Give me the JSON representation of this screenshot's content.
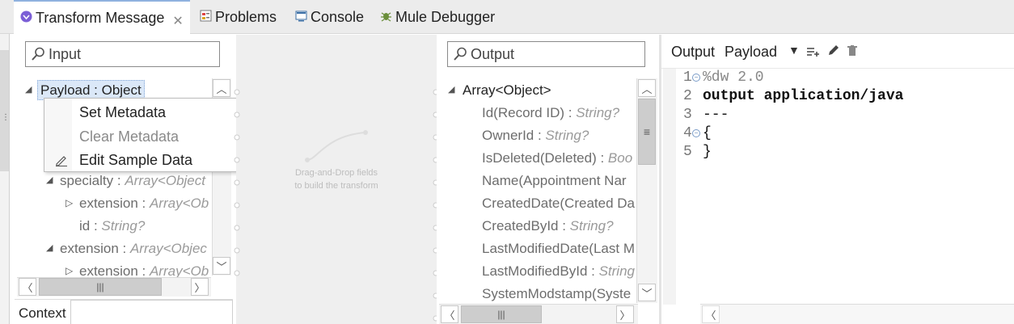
{
  "tabs": [
    {
      "label": "Transform Message",
      "icon": "transform-message-icon"
    },
    {
      "label": "Problems",
      "icon": "problems-icon"
    },
    {
      "label": "Console",
      "icon": "console-icon"
    },
    {
      "label": "Mule Debugger",
      "icon": "debugger-icon"
    }
  ],
  "input": {
    "search_placeholder": "Input",
    "tree": {
      "payload": "Payload : Object",
      "specialty_name": "specialty : ",
      "specialty_type": "Array<Object",
      "extension1_name": "extension : ",
      "extension1_type": "Array<Ob",
      "id_name": "id : ",
      "id_type": "String?",
      "extension2_name": "extension : ",
      "extension2_type": "Array<Objec",
      "extension3_name": "extension : ",
      "extension3_type": "Array<Ob"
    },
    "context_label": "Context"
  },
  "context_menu": {
    "set_metadata": "Set Metadata",
    "clear_metadata": "Clear Metadata",
    "edit_sample_data": "Edit Sample Data"
  },
  "mapping": {
    "hint_line1": "Drag-and-Drop fields",
    "hint_line2": "to build the transform"
  },
  "output": {
    "search_placeholder": "Output",
    "root": "Array<Object>",
    "fields": [
      {
        "name": "Id(Record ID) : ",
        "type": "String?"
      },
      {
        "name": "OwnerId : ",
        "type": "String?"
      },
      {
        "name": "IsDeleted(Deleted) : ",
        "type": "Boo"
      },
      {
        "name": "Name(Appointment Nar",
        "type": ""
      },
      {
        "name": "CreatedDate(Created Da",
        "type": ""
      },
      {
        "name": "CreatedById : ",
        "type": "String?"
      },
      {
        "name": "LastModifiedDate(Last M",
        "type": ""
      },
      {
        "name": "LastModifiedById : ",
        "type": "String"
      },
      {
        "name": "SystemModstamp(Syste",
        "type": ""
      }
    ]
  },
  "editor": {
    "target_label": "Output",
    "target_value": "Payload",
    "lines": [
      {
        "num": "1",
        "text": "%dw 2.0"
      },
      {
        "num": "2",
        "text": "output application/java"
      },
      {
        "num": "3",
        "text": "---"
      },
      {
        "num": "4",
        "text": "{"
      },
      {
        "num": "5",
        "text": "}"
      }
    ]
  },
  "colors": {
    "accent": "#8fb1df",
    "selection": "#dbe8f8"
  }
}
